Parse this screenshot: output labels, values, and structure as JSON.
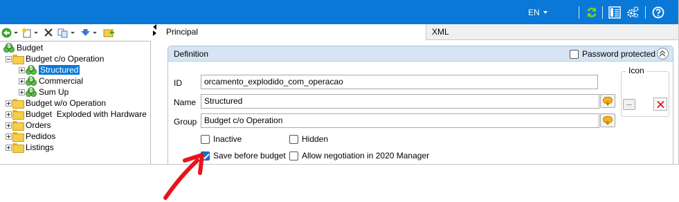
{
  "header": {
    "language": "EN",
    "accent": "#0a78d7",
    "icons": [
      "refresh-icon",
      "layout-icon",
      "settings-icon",
      "help-icon"
    ]
  },
  "toolbar": {
    "icons": [
      "back-icon",
      "new-document-icon",
      "delete-icon",
      "copy-icon",
      "move-icon",
      "export-icon"
    ]
  },
  "tree": {
    "items": [
      {
        "label": "Budget",
        "icon": "money-icon"
      },
      {
        "label": "Budget c/o Operation",
        "icon": "folder-icon"
      },
      {
        "label": "Structured",
        "icon": "money-icon",
        "selected": true
      },
      {
        "label": "Commercial",
        "icon": "money-icon"
      },
      {
        "label": "Sum Up",
        "icon": "money-icon"
      },
      {
        "label": "Budget w/o Operation",
        "icon": "folder-icon"
      },
      {
        "label": "Budget  Exploded with Hardware",
        "icon": "folder-icon"
      },
      {
        "label": "Orders",
        "icon": "folder-icon"
      },
      {
        "label": "Pedidos",
        "icon": "folder-icon"
      },
      {
        "label": "Listings",
        "icon": "folder-icon"
      }
    ]
  },
  "tabs": [
    {
      "label": "Principal",
      "active": true
    },
    {
      "label": "XML",
      "active": false
    }
  ],
  "definition": {
    "title": "Definition",
    "password_protected_label": "Password protected",
    "password_protected": false,
    "id_label": "ID",
    "id_value": "orcamento_explodido_com_operacao",
    "name_label": "Name",
    "name_value": "Structured",
    "group_label": "Group",
    "group_value": "Budget c/o Operation",
    "icon_label": "Icon",
    "icon_browse": "...",
    "inactive_label": "Inactive",
    "inactive": false,
    "hidden_label": "Hidden",
    "hidden": false,
    "save_before_budget_label": "Save before budget",
    "save_before_budget": true,
    "allow_negotiation_label": "Allow negotiation in 2020 Manager",
    "allow_negotiation": false
  },
  "annotation": {
    "arrow_color": "#e8141b"
  }
}
